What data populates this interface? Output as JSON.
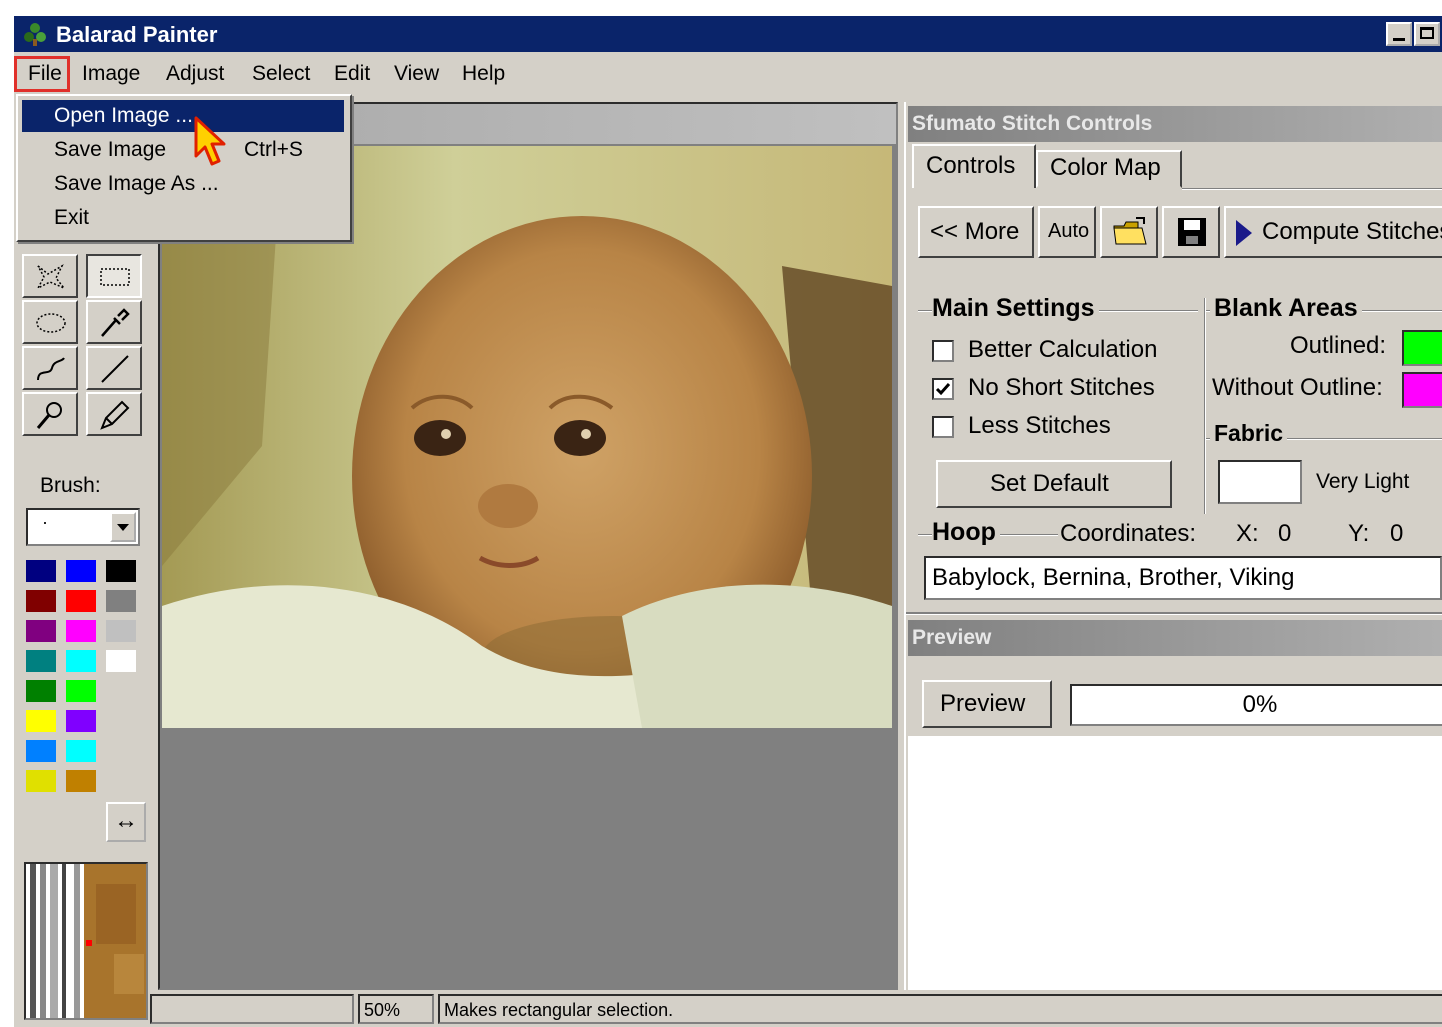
{
  "window": {
    "title": "Balarad Painter"
  },
  "menu": {
    "items": [
      "File",
      "Image",
      "Adjust",
      "Select",
      "Edit",
      "View",
      "Help"
    ]
  },
  "file_menu": {
    "items": [
      {
        "label": "Open Image ...",
        "shortcut": ""
      },
      {
        "label": "Save Image",
        "shortcut": "Ctrl+S"
      },
      {
        "label": "Save Image As ...",
        "shortcut": ""
      },
      {
        "label": "Exit",
        "shortcut": ""
      }
    ]
  },
  "toolbox": {
    "tools": [
      "lasso-tool",
      "rect-select-tool",
      "ellipse-select-tool",
      "eyedropper-tool",
      "curve-tool",
      "line-tool",
      "magnifier-tool",
      "pencil-tool"
    ],
    "brush_label": "Brush:",
    "brush_value": "·",
    "palette": [
      "#000080",
      "#0000ff",
      "#000000",
      "#800000",
      "#ff0000",
      "#808080",
      "#800080",
      "#ff00ff",
      "#c0c0c0",
      "#008080",
      "#00ffff",
      "#ffffff",
      "#008000",
      "#00ff00",
      "#808000",
      "#ffff00",
      "#8000ff",
      "#c080ff",
      "#0080ff",
      "#00ffff",
      "#80c000",
      "#e0e000",
      "#c08000",
      "#e0e000"
    ]
  },
  "panel": {
    "title": "Sfumato Stitch Controls",
    "tabs": [
      "Controls",
      "Color Map"
    ],
    "buttons": {
      "more": "<< More",
      "auto": "Auto",
      "compute": "Compute Stitches"
    },
    "main_settings": {
      "label": "Main Settings",
      "better_calculation": "Better Calculation",
      "no_short_stitches": "No Short Stitches",
      "less_stitches": "Less Stitches",
      "checked": [
        false,
        true,
        false
      ],
      "set_default": "Set Default"
    },
    "blank_areas": {
      "label": "Blank Areas",
      "outlined": "Outlined:",
      "outlined_color": "#00ff00",
      "without_outline": "Without Outline:",
      "without_outline_color": "#ff00ff"
    },
    "fabric": {
      "label": "Fabric",
      "value": "Very Light"
    },
    "hoop": {
      "label": "Hoop",
      "coordinates": "Coordinates:",
      "x_label": "X:",
      "x": "0",
      "y_label": "Y:",
      "y": "0",
      "machines": "Babylock, Bernina, Brother, Viking"
    }
  },
  "preview": {
    "title": "Preview",
    "button": "Preview",
    "progress": "0%",
    "progress_value": 0
  },
  "status": {
    "zoom": "50%",
    "message": "Makes rectangular selection."
  }
}
